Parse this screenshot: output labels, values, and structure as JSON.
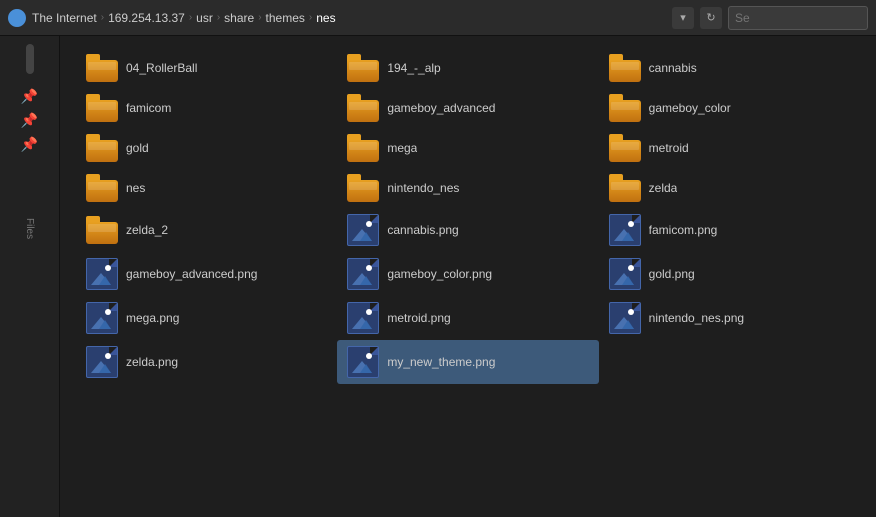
{
  "titlebar": {
    "logo_label": "The Internet",
    "breadcrumb": [
      {
        "label": "The Internet",
        "id": "bc-root"
      },
      {
        "label": "169.254.13.37",
        "id": "bc-host"
      },
      {
        "label": "usr",
        "id": "bc-usr"
      },
      {
        "label": "share",
        "id": "bc-share"
      },
      {
        "label": "themes",
        "id": "bc-themes"
      },
      {
        "label": "nes",
        "id": "bc-nes"
      }
    ],
    "search_placeholder": "Se",
    "refresh_label": "↻",
    "dropdown_label": "▾"
  },
  "sidebar": {
    "files_label": "Files",
    "pins": [
      "📌",
      "📌",
      "📌"
    ]
  },
  "files": {
    "folders": [
      {
        "name": "04_RollerBall"
      },
      {
        "name": "194_-_alp"
      },
      {
        "name": "cannabis"
      },
      {
        "name": "famicom"
      },
      {
        "name": "gameboy_advanced"
      },
      {
        "name": "gameboy_color"
      },
      {
        "name": "gold"
      },
      {
        "name": "mega"
      },
      {
        "name": "metroid"
      },
      {
        "name": "nes"
      },
      {
        "name": "nintendo_nes"
      },
      {
        "name": "zelda"
      },
      {
        "name": "zelda_2"
      }
    ],
    "images": [
      {
        "name": "cannabis.png",
        "selected": false
      },
      {
        "name": "famicom.png",
        "selected": false
      },
      {
        "name": "gameboy_advanced.png",
        "selected": false
      },
      {
        "name": "gameboy_color.png",
        "selected": false
      },
      {
        "name": "gold.png",
        "selected": false
      },
      {
        "name": "mega.png",
        "selected": false
      },
      {
        "name": "metroid.png",
        "selected": false
      },
      {
        "name": "nintendo_nes.png",
        "selected": false
      },
      {
        "name": "zelda.png",
        "selected": false
      },
      {
        "name": "my_new_theme.png",
        "selected": true
      }
    ]
  }
}
